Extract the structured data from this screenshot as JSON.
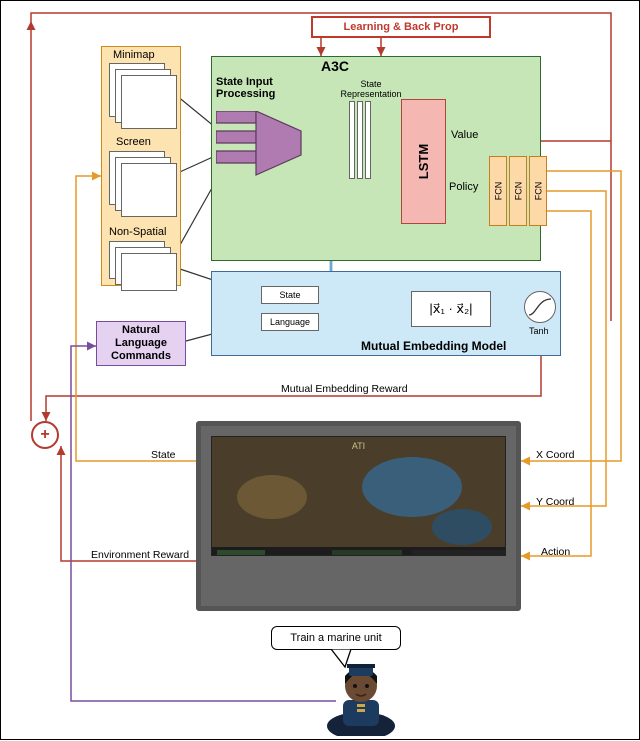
{
  "learning_label": "Learning & Back Prop",
  "a3c_label": "A3C",
  "inputs": {
    "minimap": "Minimap",
    "screen": "Screen",
    "nonspatial": "Non-Spatial"
  },
  "sip_label": "State Input Processing",
  "state_repr": "State Representation",
  "lstm": "LSTM",
  "lstm_outputs": {
    "value": "Value",
    "policy": "Policy"
  },
  "fcn": "FCN",
  "nl_commands": "Natural Language Commands",
  "mem_label": "Mutual Embedding Model",
  "mem_inputs": {
    "state": "State",
    "language": "Language"
  },
  "cosine": "|x⃗₁ · x⃗₂|",
  "tanh": "Tanh",
  "signals": {
    "me_reward": "Mutual Embedding Reward",
    "state": "State",
    "env_reward": "Environment Reward",
    "xcoord": "X Coord",
    "ycoord": "Y Coord",
    "action": "Action"
  },
  "plus": "+",
  "speech": "Train a marine unit",
  "game_title": "ATI"
}
